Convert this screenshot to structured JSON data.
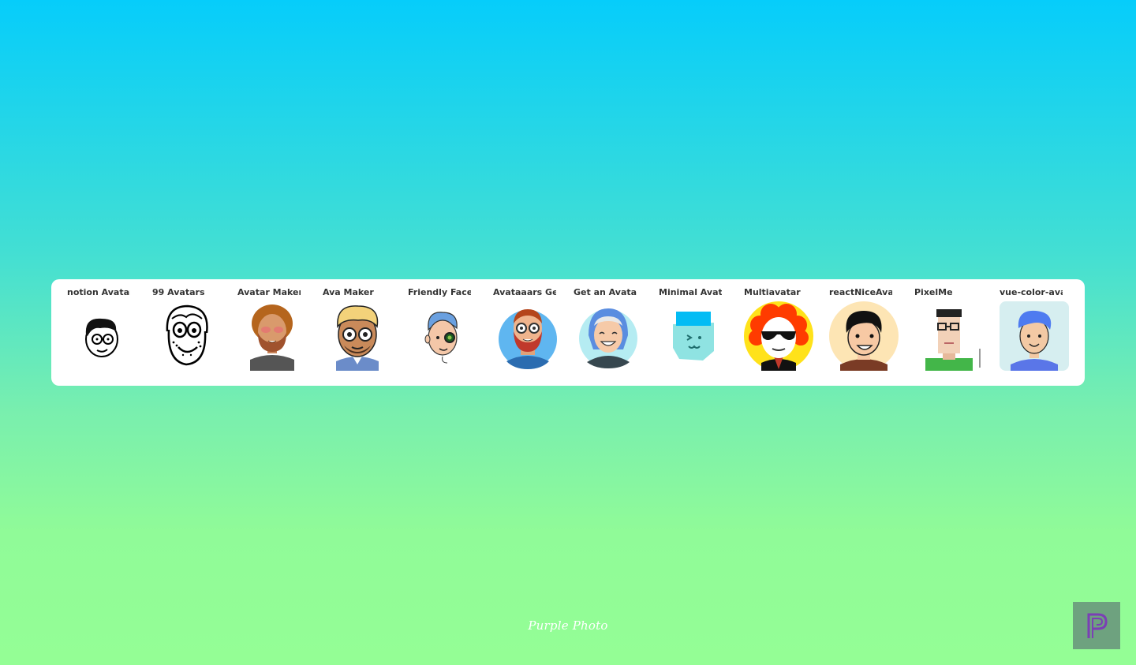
{
  "avatars": [
    {
      "label": "notion Avatar",
      "icon": "line-face-glasses-icon"
    },
    {
      "label": "99 Avatars",
      "icon": "doodle-face-icon"
    },
    {
      "label": "Avatar Maker",
      "icon": "curly-beard-avatar-icon"
    },
    {
      "label": "Ava Maker",
      "icon": "blonde-beard-avatar-icon"
    },
    {
      "label": "Friendly Faces :",
      "icon": "monocle-face-icon"
    },
    {
      "label": "Avataaars Gen",
      "icon": "red-beard-avatar-icon"
    },
    {
      "label": "Get an Avatar",
      "icon": "hooded-avatar-icon"
    },
    {
      "label": "Minimal Avatar",
      "icon": "minimal-face-icon"
    },
    {
      "label": "Multiavatar",
      "icon": "red-hair-sunglasses-icon"
    },
    {
      "label": "reactNiceAvata",
      "icon": "smiling-boy-avatar-icon"
    },
    {
      "label": "PixelMe",
      "icon": "pixel-avatar-icon"
    },
    {
      "label": "vue-color-avatar",
      "icon": "blue-hair-avatar-icon"
    }
  ],
  "watermark": "Purple Photo",
  "brand_badge_icon": "purple-p-logo-icon",
  "colors": {
    "gradient_top": "#06cdfb",
    "gradient_bottom": "#94fe95",
    "card": "#ffffff",
    "badge": "#6ea27f",
    "badge_logo": "#7b3fb5"
  }
}
